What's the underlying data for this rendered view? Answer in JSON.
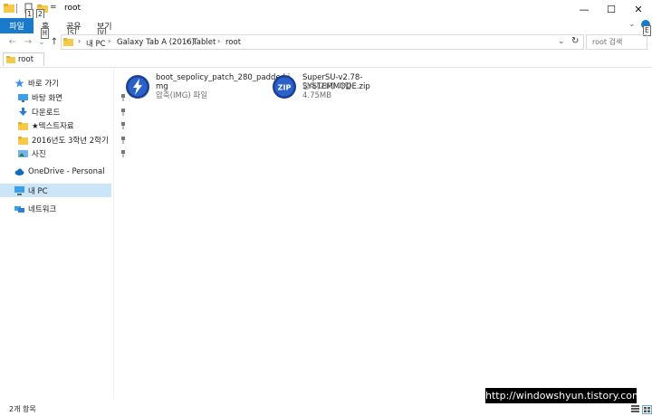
{
  "window": {
    "title": "root",
    "minimize_glyph": "—",
    "maximize_glyph": "☐",
    "close_glyph": "✕"
  },
  "quick_access": {
    "keytips": [
      "1",
      "2"
    ],
    "dropdown_glyph": "="
  },
  "ribbon": {
    "file_label": "파일",
    "tabs": [
      {
        "label": "홈",
        "keytip": "H"
      },
      {
        "label": "공유",
        "keytip": "S"
      },
      {
        "label": "보기",
        "keytip": "V"
      }
    ],
    "help_keytip": "E"
  },
  "navigation": {
    "back_glyph": "←",
    "forward_glyph": "→",
    "recent_glyph": "⌄",
    "up_glyph": "↑"
  },
  "address": {
    "crumbs": [
      "내 PC",
      "Galaxy Tab A (2016)",
      "Tablet",
      "root"
    ],
    "sep": "›",
    "refresh_glyph": "↻",
    "dropdown_glyph": "⌄"
  },
  "search": {
    "placeholder": "root 검색"
  },
  "tab": {
    "label": "root"
  },
  "sidebar": {
    "quick_access": "바로 가기",
    "items": [
      {
        "label": "바탕 화면",
        "icon": "desktop-icon"
      },
      {
        "label": "다운로드",
        "icon": "download-icon"
      },
      {
        "label": "★텍스트자료",
        "icon": "folder-icon"
      },
      {
        "label": "2016년도 3학년 2학기",
        "icon": "folder-icon"
      },
      {
        "label": "사진",
        "icon": "pictures-icon"
      }
    ],
    "onedrive": "OneDrive - Personal",
    "this_pc": "내 PC",
    "network": "네트워크"
  },
  "files": [
    {
      "name_line1": "boot_sepolicy_patch_280_padded.i",
      "name_line2": "mg",
      "type": "압축(IMG) 파일",
      "size": ""
    },
    {
      "name_line1": "SuperSU-v2.78-SYSTEMMODE.zip",
      "name_line2": "",
      "type": "압축(ZIP) 파일",
      "size": "4.75MB"
    }
  ],
  "status": {
    "count": "2개 항목"
  },
  "watermark": "http://windowshyun.tistory.com",
  "colors": {
    "accent": "#1979ca",
    "selection": "#cce4f7"
  }
}
